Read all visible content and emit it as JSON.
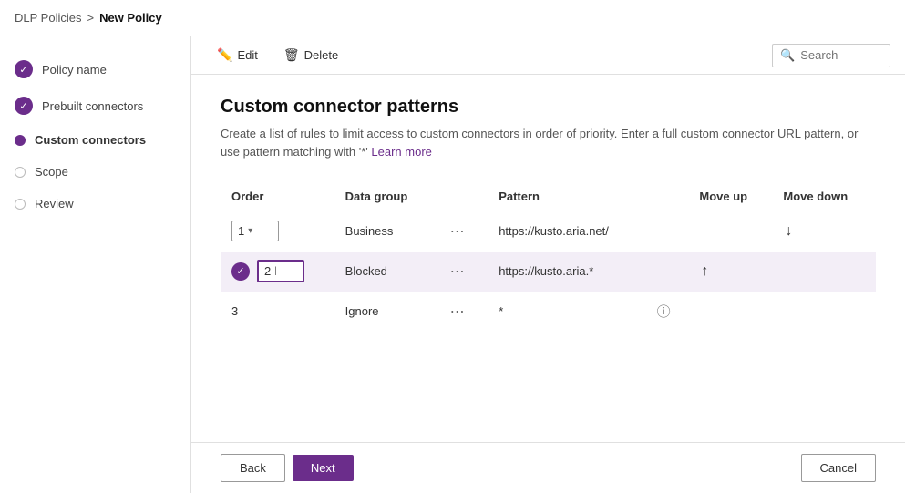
{
  "breadcrumb": {
    "parent": "DLP Policies",
    "separator": ">",
    "current": "New Policy"
  },
  "sidebar": {
    "items": [
      {
        "id": "policy-name",
        "label": "Policy name",
        "state": "completed"
      },
      {
        "id": "prebuilt-connectors",
        "label": "Prebuilt connectors",
        "state": "completed"
      },
      {
        "id": "custom-connectors",
        "label": "Custom connectors",
        "state": "active"
      },
      {
        "id": "scope",
        "label": "Scope",
        "state": "empty"
      },
      {
        "id": "review",
        "label": "Review",
        "state": "empty"
      }
    ]
  },
  "toolbar": {
    "edit_label": "Edit",
    "delete_label": "Delete",
    "search_placeholder": "Search"
  },
  "page": {
    "title": "Custom connector patterns",
    "description": "Create a list of rules to limit access to custom connectors in order of priority. Enter a full custom connector URL pattern, or use pattern matching with '*'",
    "learn_more": "Learn more"
  },
  "table": {
    "headers": [
      "Order",
      "Data group",
      "",
      "Pattern",
      "",
      "Move up",
      "Move down"
    ],
    "rows": [
      {
        "order": "1",
        "data_group": "Business",
        "pattern": "https://kusto.aria.net/",
        "move_up": false,
        "move_down": true,
        "highlighted": false,
        "checked": false
      },
      {
        "order": "2",
        "data_group": "Blocked",
        "pattern": "https://kusto.aria.*",
        "move_up": true,
        "move_down": false,
        "highlighted": true,
        "checked": true
      },
      {
        "order": "3",
        "data_group": "Ignore",
        "pattern": "*",
        "move_up": false,
        "move_down": false,
        "highlighted": false,
        "checked": false,
        "info": true
      }
    ]
  },
  "footer": {
    "back_label": "Back",
    "next_label": "Next",
    "cancel_label": "Cancel"
  }
}
